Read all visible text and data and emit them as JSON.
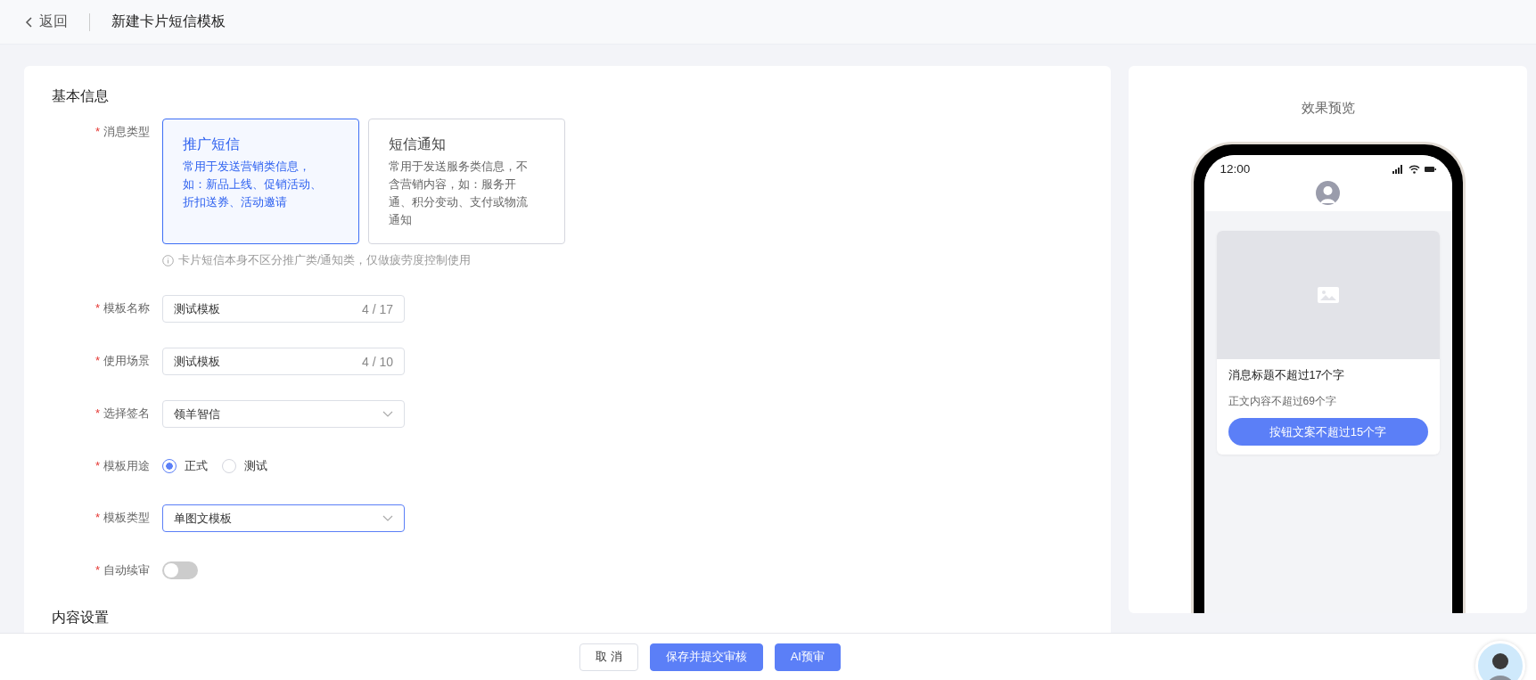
{
  "header": {
    "back": "返回",
    "title": "新建卡片短信模板"
  },
  "form": {
    "section": "基本信息",
    "message_type": {
      "label": "消息类型",
      "mark": "*",
      "options": [
        {
          "title": "推广短信",
          "description": "常用于发送营销类信息，如：新品上线、促销活动、折扣送券、活动邀请",
          "selected": true
        },
        {
          "title": "短信通知",
          "description": "常用于发送服务类信息，不含营销内容，如：服务开通、积分变动、支付或物流通知",
          "selected": false
        }
      ],
      "hint": "卡片短信本身不区分推广类/通知类，仅做疲劳度控制使用"
    },
    "fields": [
      {
        "kind": "text",
        "label": "模板名称",
        "mark": "*",
        "value": "测试模板",
        "count": "4 / 17"
      },
      {
        "kind": "text",
        "label": "使用场景",
        "mark": "*",
        "value": "测试模板",
        "count": "4 / 10"
      },
      {
        "kind": "select",
        "label": "选择签名",
        "mark": "*",
        "value": "领羊智信",
        "focused": false
      },
      {
        "kind": "radio",
        "label": "模板用途",
        "mark": "*",
        "options": [
          {
            "label": "正式",
            "selected": true
          },
          {
            "label": "测试",
            "selected": false
          }
        ]
      },
      {
        "kind": "select",
        "label": "模板类型",
        "mark": "*",
        "value": "单图文模板",
        "focused": true
      },
      {
        "kind": "switch",
        "label": "自动续审",
        "mark": "*",
        "on": false
      }
    ],
    "next_section": "内容设置"
  },
  "preview": {
    "title": "效果预览",
    "time": "12:00",
    "card_title": "消息标题不超过17个字",
    "card_body": "正文内容不超过69个字",
    "card_button": "按钮文案不超过15个字"
  },
  "footer": {
    "buttons": [
      {
        "label": "取 消",
        "kind": "default"
      },
      {
        "label": "保存并提交审核",
        "kind": "primary"
      },
      {
        "label": "AI预审",
        "kind": "primary"
      }
    ]
  }
}
